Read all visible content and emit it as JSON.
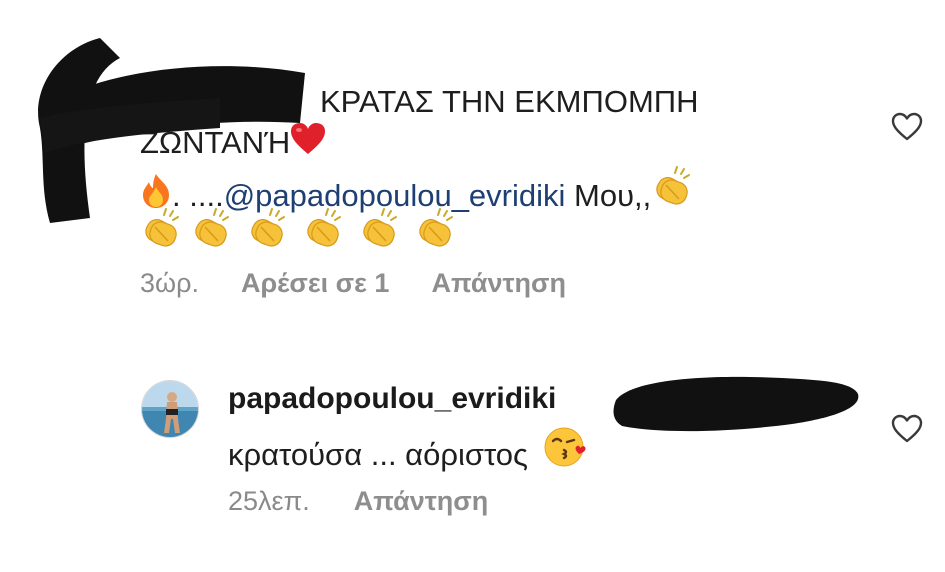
{
  "comment1": {
    "line1": "ΚΡΑΤΑΣ ΤΗΝ ΕΚΜΠΟΜΠΗ",
    "line2": "ΖΩΝΤΑΝΉ",
    "line3_prefix": ". ....",
    "line3_mention": "@papadopoulou_evridiki",
    "line3_suffix": " Μου,,",
    "time": "3ώρ.",
    "likes": "Αρέσει σε 1",
    "reply": "Απάντηση",
    "emojis": [
      "red-heart",
      "fire",
      "clapping-hands",
      "clapping-hands",
      "clapping-hands",
      "clapping-hands",
      "clapping-hands",
      "clapping-hands",
      "clapping-hands"
    ]
  },
  "comment2": {
    "username": "papadopoulou_evridiki",
    "text": "κρατούσα ... αόριστος",
    "emoji": "face-blowing-a-kiss",
    "time": "25λεπ.",
    "reply": "Απάντηση"
  },
  "icons": [
    "heart-outline-icon",
    "heart-outline-icon"
  ],
  "colors": {
    "text": "#1e1e1e",
    "meta": "#8a8a8a",
    "mention": "#1d3f73",
    "heart": "#e0212b",
    "redaction": "#111111"
  }
}
